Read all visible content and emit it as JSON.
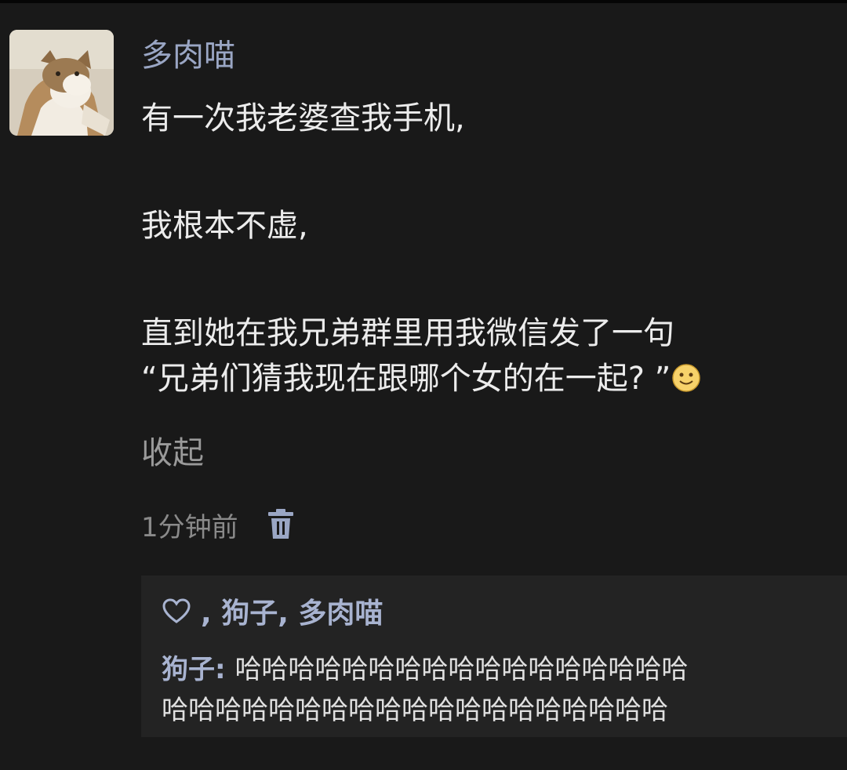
{
  "post": {
    "username": "多肉喵",
    "avatar_icon": "cat-avatar-icon",
    "paragraphs": [
      "有一次我老婆查我手机,",
      "我根本不虚,",
      "直到她在我兄弟群里用我微信发了一句"
    ],
    "quote_line": "“兄弟们猜我现在跟哪个女的在一起? ”",
    "emoji_icon": "smile-emoji-icon",
    "collapse_label": "收起",
    "timestamp": "1分钟前",
    "delete_icon": "trash-icon"
  },
  "interactions": {
    "like_icon": "heart-icon",
    "likers": ", 狗子, 多肉喵",
    "comment": {
      "author": "狗子",
      "separator": ": ",
      "text_line1": "哈哈哈哈哈哈哈哈哈哈哈哈哈哈哈哈哈",
      "text_line2": "哈哈哈哈哈哈哈哈哈哈哈哈哈哈哈哈哈哈哈"
    }
  },
  "colors": {
    "background": "#191919",
    "name_blue": "#9aa6c4",
    "comment_panel": "#232323",
    "text": "#ececec",
    "muted": "#8a8a8a"
  }
}
